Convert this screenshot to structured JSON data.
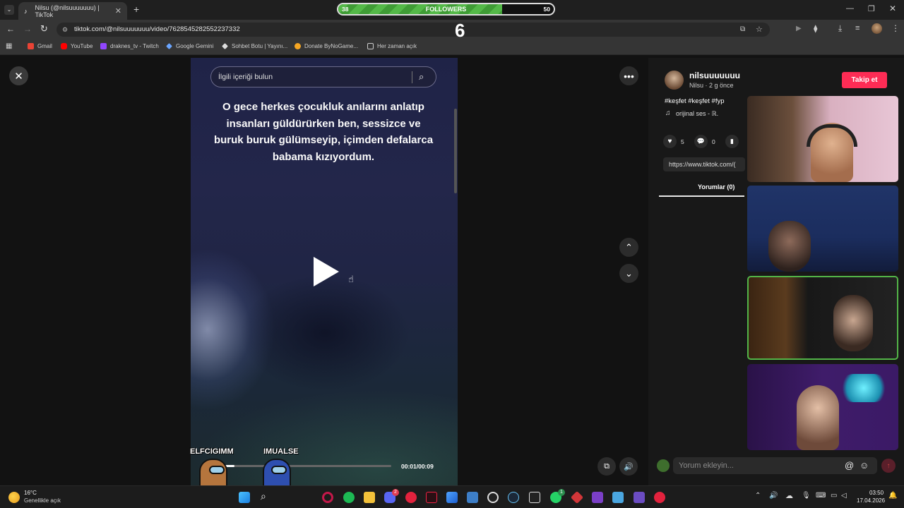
{
  "browser": {
    "tab_title": "Nilsu (@nilsuuuuuuu) | TikTok",
    "url": "tiktok.com/@nilsuuuuuuu/video/7628545282552237332",
    "bookmarks": [
      "Gmail",
      "YouTube",
      "draknes_tv - Twitch",
      "Google Gemini",
      "Sohbet Botu | Yayını...",
      "Donate ByNoGame...",
      "Her zaman açık"
    ]
  },
  "overlay": {
    "followers_label": "FOLLOWERS",
    "followers_current": "38",
    "followers_goal": "50",
    "followers_progress": 0.76,
    "kick_count": "6"
  },
  "video": {
    "search_placeholder": "İlgili içeriği bulun",
    "caption": "O gece herkes çocukluk anılarını anlatıp insanları güldürürken ben, sessizce ve buruk buruk gülümseyip, içimden defalarca babama kızıyordum.",
    "time": "00:01/00:09",
    "progress": 0.11,
    "players": [
      "ELFCIGIMM",
      "IMUALSE"
    ]
  },
  "post": {
    "username": "nilsuuuuuuu",
    "meta": "Nilsu · 2 g önce",
    "follow_label": "Takip et",
    "hashtags": "#keşfet #keşfet #fyp",
    "sound": "orijinal ses - ℝ.",
    "likes": "5",
    "comments": "0",
    "share_url": "https://www.tiktok.com/(",
    "comments_tab": "Yorumlar (0)",
    "comment_placeholder": "Yorum ekleyin..."
  },
  "taskbar": {
    "weather_temp": "16°C",
    "weather_text": "Genellikle açık",
    "time": "03:50",
    "date": "17.04.2026",
    "badges": {
      "discord": "2",
      "whatsapp": "1"
    }
  }
}
